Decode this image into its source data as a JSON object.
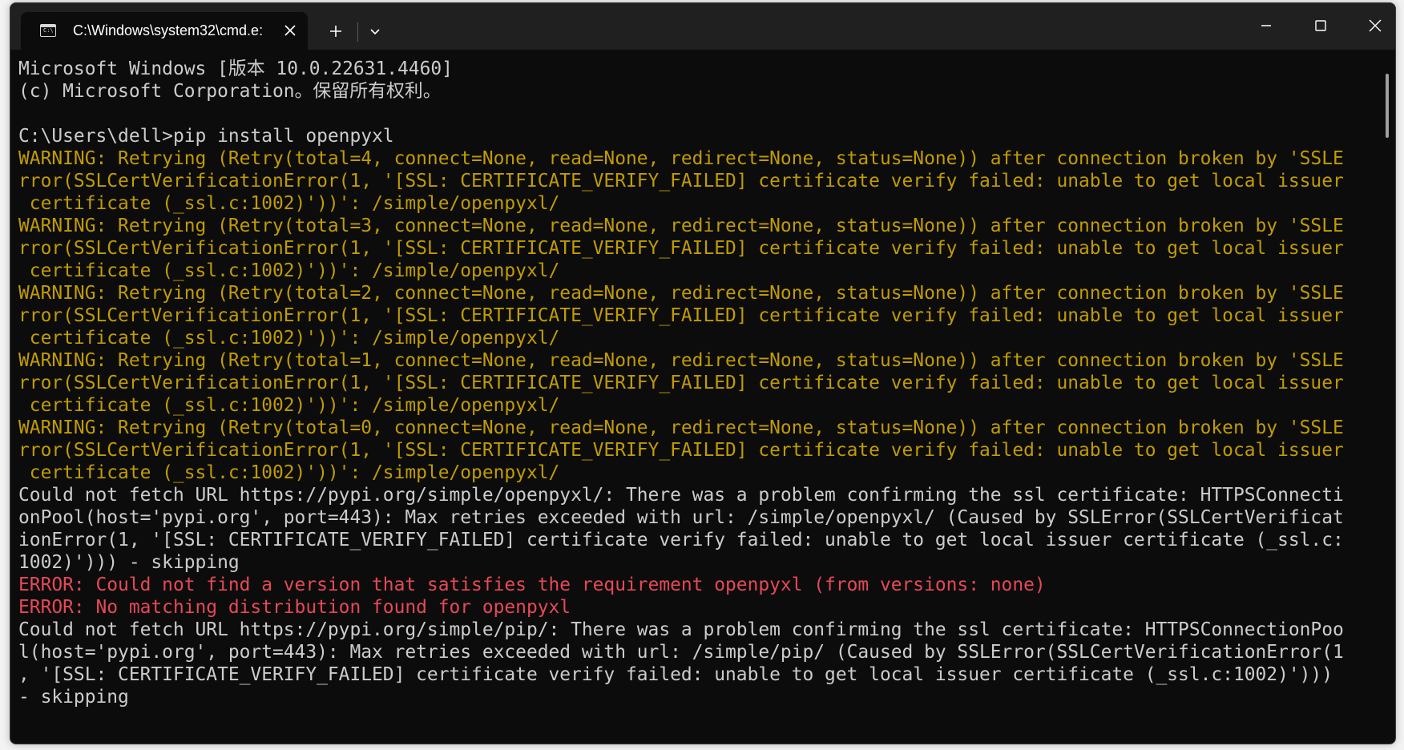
{
  "tab": {
    "title": "C:\\Windows\\system32\\cmd.e:",
    "icon_glyph": "C:\\"
  },
  "titlebar": {
    "new_tab": "+",
    "close_tab": "✕"
  },
  "terminal": {
    "lines": [
      {
        "type": "normal",
        "text": "Microsoft Windows [版本 10.0.22631.4460]"
      },
      {
        "type": "normal",
        "text": "(c) Microsoft Corporation。保留所有权利。"
      },
      {
        "type": "normal",
        "text": ""
      },
      {
        "type": "normal",
        "text": "C:\\Users\\dell>pip install openpyxl"
      },
      {
        "type": "warn",
        "text": "WARNING: Retrying (Retry(total=4, connect=None, read=None, redirect=None, status=None)) after connection broken by 'SSLE"
      },
      {
        "type": "warn",
        "text": "rror(SSLCertVerificationError(1, '[SSL: CERTIFICATE_VERIFY_FAILED] certificate verify failed: unable to get local issuer"
      },
      {
        "type": "warn",
        "text": " certificate (_ssl.c:1002)'))': /simple/openpyxl/"
      },
      {
        "type": "warn",
        "text": "WARNING: Retrying (Retry(total=3, connect=None, read=None, redirect=None, status=None)) after connection broken by 'SSLE"
      },
      {
        "type": "warn",
        "text": "rror(SSLCertVerificationError(1, '[SSL: CERTIFICATE_VERIFY_FAILED] certificate verify failed: unable to get local issuer"
      },
      {
        "type": "warn",
        "text": " certificate (_ssl.c:1002)'))': /simple/openpyxl/"
      },
      {
        "type": "warn",
        "text": "WARNING: Retrying (Retry(total=2, connect=None, read=None, redirect=None, status=None)) after connection broken by 'SSLE"
      },
      {
        "type": "warn",
        "text": "rror(SSLCertVerificationError(1, '[SSL: CERTIFICATE_VERIFY_FAILED] certificate verify failed: unable to get local issuer"
      },
      {
        "type": "warn",
        "text": " certificate (_ssl.c:1002)'))': /simple/openpyxl/"
      },
      {
        "type": "warn",
        "text": "WARNING: Retrying (Retry(total=1, connect=None, read=None, redirect=None, status=None)) after connection broken by 'SSLE"
      },
      {
        "type": "warn",
        "text": "rror(SSLCertVerificationError(1, '[SSL: CERTIFICATE_VERIFY_FAILED] certificate verify failed: unable to get local issuer"
      },
      {
        "type": "warn",
        "text": " certificate (_ssl.c:1002)'))': /simple/openpyxl/"
      },
      {
        "type": "warn",
        "text": "WARNING: Retrying (Retry(total=0, connect=None, read=None, redirect=None, status=None)) after connection broken by 'SSLE"
      },
      {
        "type": "warn",
        "text": "rror(SSLCertVerificationError(1, '[SSL: CERTIFICATE_VERIFY_FAILED] certificate verify failed: unable to get local issuer"
      },
      {
        "type": "warn",
        "text": " certificate (_ssl.c:1002)'))': /simple/openpyxl/"
      },
      {
        "type": "normal",
        "text": "Could not fetch URL https://pypi.org/simple/openpyxl/: There was a problem confirming the ssl certificate: HTTPSConnecti"
      },
      {
        "type": "normal",
        "text": "onPool(host='pypi.org', port=443): Max retries exceeded with url: /simple/openpyxl/ (Caused by SSLError(SSLCertVerificat"
      },
      {
        "type": "normal",
        "text": "ionError(1, '[SSL: CERTIFICATE_VERIFY_FAILED] certificate verify failed: unable to get local issuer certificate (_ssl.c:"
      },
      {
        "type": "normal",
        "text": "1002)'))) - skipping"
      },
      {
        "type": "err",
        "text": "ERROR: Could not find a version that satisfies the requirement openpyxl (from versions: none)"
      },
      {
        "type": "err",
        "text": "ERROR: No matching distribution found for openpyxl"
      },
      {
        "type": "normal",
        "text": "Could not fetch URL https://pypi.org/simple/pip/: There was a problem confirming the ssl certificate: HTTPSConnectionPoo"
      },
      {
        "type": "normal",
        "text": "l(host='pypi.org', port=443): Max retries exceeded with url: /simple/pip/ (Caused by SSLError(SSLCertVerificationError(1"
      },
      {
        "type": "normal",
        "text": ", '[SSL: CERTIFICATE_VERIFY_FAILED] certificate verify failed: unable to get local issuer certificate (_ssl.c:1002)')))"
      },
      {
        "type": "normal",
        "text": "- skipping"
      }
    ]
  },
  "colors": {
    "background": "#0c0c0c",
    "titlebar": "#202020",
    "text": "#cccccc",
    "warning": "#c19c00",
    "error": "#e74856"
  },
  "icons": {
    "tab_icon": "terminal-icon",
    "tab_close": "close-icon",
    "new_tab": "plus-icon",
    "dropdown": "chevron-down-icon",
    "minimize": "minimize-icon",
    "maximize": "maximize-icon",
    "close": "close-icon"
  }
}
